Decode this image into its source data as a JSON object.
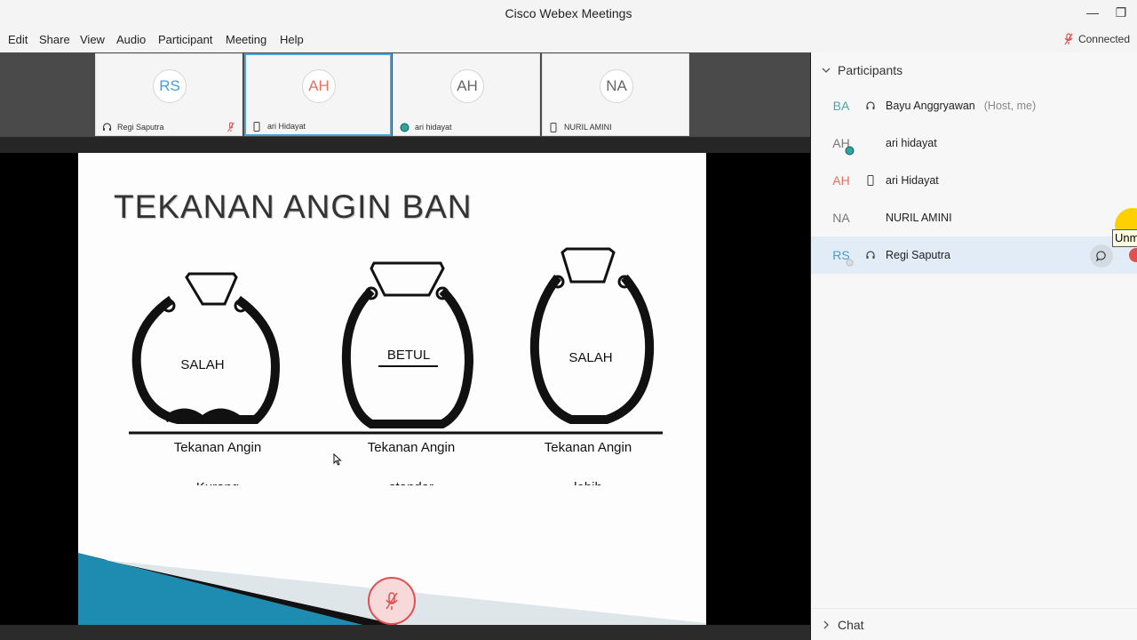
{
  "window": {
    "title": "Cisco Webex Meetings",
    "minimize": "—",
    "restore": "❐"
  },
  "menu": {
    "items": [
      "Edit",
      "Share",
      "View",
      "Audio",
      "Participant",
      "Meeting",
      "Help"
    ],
    "status": "Connected"
  },
  "video_strip": {
    "tiles": [
      {
        "initials": "RS",
        "name": "Regi Saputra",
        "color": "#4a9cd6",
        "device": "headset-icon",
        "muted": true
      },
      {
        "initials": "AH",
        "name": "ari Hidayat",
        "color": "#e8705f",
        "device": "phone-icon",
        "active": true
      },
      {
        "initials": "AH",
        "name": "ari hidayat",
        "color": "#666666",
        "device": "status-dot-icon"
      },
      {
        "initials": "NA",
        "name": "NURIL AMINI",
        "color": "#666666",
        "device": "phone-icon"
      }
    ]
  },
  "slide": {
    "title": "TEKANAN ANGIN BAN",
    "tires": [
      {
        "label": "SALAH",
        "caption": "Tekanan Angin",
        "caption2": "Kurang"
      },
      {
        "label": "BETUL",
        "caption": "Tekanan Angin",
        "caption2": "standar"
      },
      {
        "label": "SALAH",
        "caption": "Tekanan Angin",
        "caption2": "lebih"
      }
    ]
  },
  "panel": {
    "header": "Participants",
    "participants": [
      {
        "initials": "BA",
        "name": "Bayu Anggryawan",
        "role": "(Host, me)",
        "color": "#4aa6a6",
        "device": "headset-icon"
      },
      {
        "initials": "AH",
        "name": "ari hidayat",
        "role": "",
        "color": "#777777",
        "device": "status-dot-icon"
      },
      {
        "initials": "AH",
        "name": "ari Hidayat",
        "role": "",
        "color": "#e8705f",
        "device": "phone-icon"
      },
      {
        "initials": "NA",
        "name": "NURIL AMINI",
        "role": "",
        "color": "#777777",
        "device": "none"
      },
      {
        "initials": "RS",
        "name": "Regi Saputra",
        "role": "",
        "color": "#4a9cd6",
        "device": "headset-icon",
        "selected": true
      }
    ],
    "tooltip": "Unmute",
    "chat_label": "Chat"
  },
  "colors": {
    "accent": "#4ba4d9",
    "mute_red": "#e05050"
  }
}
